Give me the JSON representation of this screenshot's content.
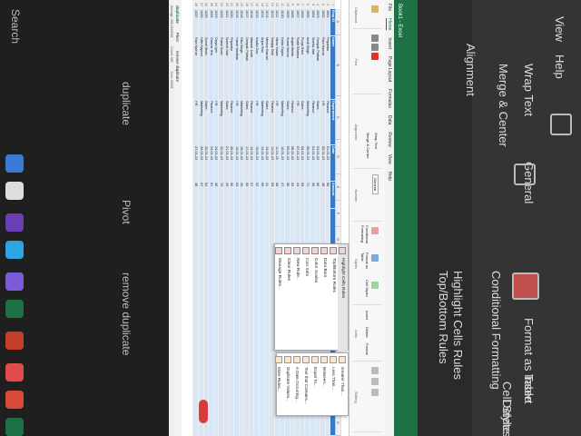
{
  "colors": {
    "excel_green": "#1e7145",
    "header_blue": "#3b78c4",
    "menu_highlight": "#e5e5e5"
  },
  "window": {
    "title": "Book1 - Excel",
    "menu": [
      "File",
      "Home",
      "Insert",
      "Page Layout",
      "Formulas",
      "Data",
      "Review",
      "View",
      "Help"
    ],
    "active_menu": "Home"
  },
  "ribbon": {
    "groups": [
      "Clipboard",
      "Font",
      "Alignment",
      "Number",
      "Styles",
      "Cells",
      "Editing"
    ],
    "wrap_text": "Wrap Text",
    "merge_center": "Merge & Center",
    "number_format": "General",
    "conditional_formatting": "Conditional Formatting",
    "format_as_table": "Format as Table",
    "cell_styles": "Cell Styles",
    "insert": "Insert",
    "delete": "Delete",
    "format": "Format"
  },
  "cf_menu": {
    "items": [
      {
        "label": "Highlight Cells Rules",
        "icon": "highlight-rules-icon"
      },
      {
        "label": "Top/Bottom Rules",
        "icon": "top-bottom-icon"
      },
      {
        "label": "Data Bars",
        "icon": "data-bars-icon"
      },
      {
        "label": "Color Scales",
        "icon": "color-scales-icon"
      },
      {
        "label": "Icon Sets",
        "icon": "icon-sets-icon"
      },
      {
        "label": "New Rule...",
        "icon": "new-rule-icon"
      },
      {
        "label": "Clear Rules",
        "icon": "clear-rules-icon"
      },
      {
        "label": "Manage Rules...",
        "icon": "manage-rules-icon"
      }
    ]
  },
  "submenu": {
    "items": [
      {
        "label": "Greater Than..."
      },
      {
        "label": "Less Than..."
      },
      {
        "label": "Between..."
      },
      {
        "label": "Equal To..."
      },
      {
        "label": "Text that Contains..."
      },
      {
        "label": "A Date Occurring..."
      },
      {
        "label": "Duplicate Values..."
      },
      {
        "label": "More Rules..."
      }
    ]
  },
  "sheet": {
    "headers": [
      "Emp ID",
      "Name",
      "Department",
      "Date",
      "Amount"
    ],
    "rows": [
      [
        "1001",
        "Priyanka",
        "Finance",
        "01-01-22",
        "50"
      ],
      [
        "1002",
        "Ravi Kumar",
        "HR",
        "02-01-22",
        "48"
      ],
      [
        "1003",
        "Deepak Pathak",
        "Sales",
        "03-01-22",
        "60"
      ],
      [
        "1004",
        "Sneha Jain",
        "Finance",
        "04-01-22",
        "39"
      ],
      [
        "1005",
        "Amit Singh",
        "Marketing",
        "05-01-22",
        "71"
      ],
      [
        "1006",
        "Pooja Rani",
        "Sales",
        "06-01-22",
        "55"
      ],
      [
        "1007",
        "Rohit Sharma",
        "HR",
        "07-01-22",
        "44"
      ],
      [
        "1008",
        "Anjali Mehta",
        "Finance",
        "08-01-22",
        "62"
      ],
      [
        "1009",
        "Kunal Verma",
        "Sales",
        "09-01-22",
        "58"
      ],
      [
        "1010",
        "Neha Gupta",
        "Marketing",
        "10-01-22",
        "47"
      ],
      [
        "1011",
        "Vikas Yadav",
        "HR",
        "11-01-22",
        "66"
      ],
      [
        "1012",
        "Sanjay Dutt",
        "Finance",
        "12-01-22",
        "53"
      ],
      [
        "1013",
        "Meena Kumari",
        "Sales",
        "13-01-22",
        "41"
      ],
      [
        "1014",
        "Arjun Rao",
        "Marketing",
        "14-01-22",
        "69"
      ],
      [
        "1015",
        "Kavita Das",
        "HR",
        "15-01-22",
        "52"
      ],
      [
        "1016",
        "Manish Joshi",
        "Finance",
        "16-01-22",
        "57"
      ],
      [
        "1017",
        "Deepak Pathak",
        "Sales",
        "17-01-22",
        "60"
      ],
      [
        "1018",
        "Ritu Singh",
        "Marketing",
        "18-01-22",
        "45"
      ],
      [
        "1019",
        "Harsh Vardhan",
        "HR",
        "19-01-22",
        "63"
      ],
      [
        "1020",
        "Priyanka",
        "Finance",
        "20-01-22",
        "50"
      ],
      [
        "1021",
        "Suresh Nair",
        "Sales",
        "21-01-22",
        "49"
      ],
      [
        "1022",
        "Rahul Bose",
        "Marketing",
        "22-01-22",
        "72"
      ],
      [
        "1023",
        "Divya Iyer",
        "HR",
        "23-01-22",
        "38"
      ],
      [
        "1024",
        "Gaurav Jha",
        "Finance",
        "24-01-22",
        "61"
      ],
      [
        "1025",
        "Sonal Shah",
        "Sales",
        "25-01-22",
        "54"
      ],
      [
        "1026",
        "Nitin Kapoor",
        "Marketing",
        "26-01-22",
        "67"
      ],
      [
        "1027",
        "Ravi Kumar",
        "HR",
        "27-01-22",
        "48"
      ]
    ]
  },
  "sheet_tabs": [
    "duplicate",
    "Pivot",
    "remove duplicate"
  ],
  "active_tab": "duplicate",
  "status": {
    "average": "Average: 208.2164948",
    "count": "Count: 583",
    "sum": "Sum: 40393"
  },
  "bg_left": {
    "labels": [
      "Pivot",
      "duplicate",
      "remove duplicate",
      "Search"
    ]
  },
  "bg_right": {
    "labels": [
      "View",
      "Help",
      "Alignment",
      "Wrap Text",
      "Merge & Center",
      "General",
      "Conditional Formatting",
      "Format as Table",
      "Cell Styles",
      "Highlight Cells Rules",
      "Top/Bottom Rules",
      "Insert",
      "Delete"
    ]
  }
}
